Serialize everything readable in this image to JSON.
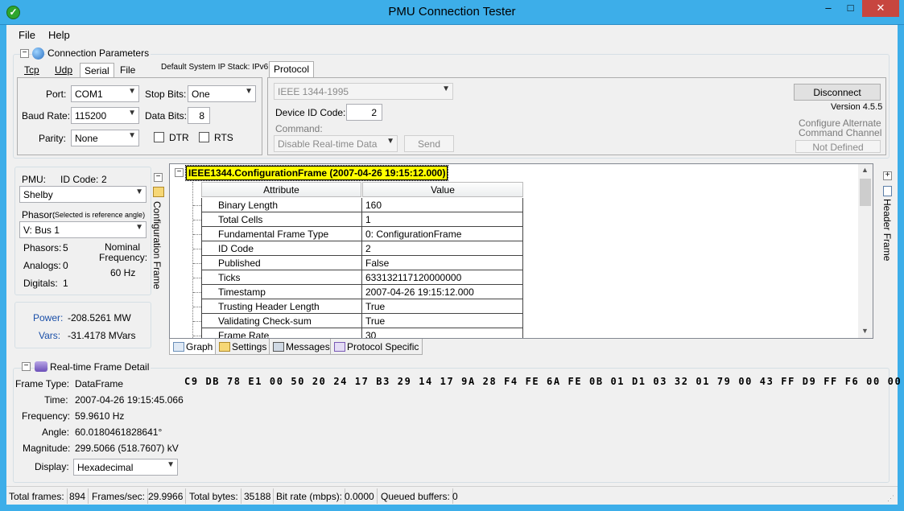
{
  "window": {
    "title": "PMU Connection Tester",
    "min": "–",
    "max": "□",
    "close": "✕"
  },
  "menu": {
    "file": "File",
    "help": "Help"
  },
  "connection": {
    "title": "Connection Parameters",
    "tabs": [
      "Tcp",
      "Udp",
      "Serial",
      "File"
    ],
    "ip_stack": "Default System IP Stack: IPv6",
    "port_label": "Port:",
    "port_value": "COM1",
    "stopbits_label": "Stop Bits:",
    "stopbits_value": "One",
    "baud_label": "Baud Rate:",
    "baud_value": "115200",
    "databits_label": "Data Bits:",
    "databits_value": "8",
    "parity_label": "Parity:",
    "parity_value": "None",
    "dtr_label": "DTR",
    "rts_label": "RTS"
  },
  "protocol": {
    "tab": "Protocol",
    "selected": "IEEE 1344-1995",
    "device_id_label": "Device ID Code:",
    "device_id_value": "2",
    "command_label": "Command:",
    "command_value": "Disable Real-time Data",
    "send": "Send",
    "disconnect": "Disconnect",
    "version": "Version 4.5.5",
    "alt_channel_1": "Configure Alternate",
    "alt_channel_2": "Command Channel",
    "not_defined": "Not Defined"
  },
  "pmu": {
    "pmu_label": "PMU:",
    "id_code_label": "ID Code:",
    "id_code_value": "2",
    "station": "Shelby",
    "phasor_label": "Phasor:",
    "phasor_hint": "(Selected is reference angle)",
    "phasor_value": "V: Bus 1",
    "phasors_label": "Phasors:",
    "phasors_value": "5",
    "analogs_label": "Analogs:",
    "analogs_value": "0",
    "digitals_label": "Digitals:",
    "digitals_value": "1",
    "nominal_label_1": "Nominal",
    "nominal_label_2": "Frequency:",
    "nominal_value": "60 Hz",
    "power_label": "Power:",
    "power_value": "-208.5261 MW",
    "vars_label": "Vars:",
    "vars_value": "-31.4178 MVars",
    "config_frame_vertical": "Configuration Frame"
  },
  "tree": {
    "root": "IEEE1344.ConfigurationFrame (2007-04-26 19:15:12.000)",
    "col_attribute": "Attribute",
    "col_value": "Value",
    "rows": [
      [
        "Binary Length",
        "160"
      ],
      [
        "Total Cells",
        "1"
      ],
      [
        "Fundamental Frame Type",
        "0: ConfigurationFrame"
      ],
      [
        "ID Code",
        "2"
      ],
      [
        "Published",
        "False"
      ],
      [
        "Ticks",
        "633132117120000000"
      ],
      [
        "Timestamp",
        "2007-04-26 19:15:12.000"
      ],
      [
        "Trusting Header Length",
        "True"
      ],
      [
        "Validating Check-sum",
        "True"
      ],
      [
        "Frame Rate",
        "30"
      ]
    ]
  },
  "bottom_tabs": [
    "Graph",
    "Settings",
    "Messages",
    "Protocol Specific"
  ],
  "header_frame_vertical": "Header Frame",
  "realtime": {
    "title": "Real-time Frame Detail",
    "frame_type_label": "Frame Type:",
    "frame_type_value": "DataFrame",
    "time_label": "Time:",
    "time_value": "2007-04-26 19:15:45.066",
    "frequency_label": "Frequency:",
    "frequency_value": "59.9610 Hz",
    "angle_label": "Angle:",
    "angle_value": "60.0180461828641°",
    "magnitude_label": "Magnitude:",
    "magnitude_value": "299.5066 (518.7607) kV",
    "display_label": "Display:",
    "display_value": "Hexadecimal",
    "hex": "C9 DB 78 E1 00 50 20 24 17 B3 29 14 17 9A 28 F4 FE 6A FE 0B 01 D1 03 32 01 79 00 43 FF D9 FF F6 00 00 3D"
  },
  "status": {
    "total_frames_label": "Total frames:",
    "total_frames_value": "894",
    "fps_label": "Frames/sec:",
    "fps_value": "29.9966",
    "total_bytes_label": "Total bytes:",
    "total_bytes_value": "35188",
    "bitrate_label": "Bit rate (mbps):",
    "bitrate_value": "0.0000",
    "queued_label": "Queued buffers:",
    "queued_value": "0"
  }
}
